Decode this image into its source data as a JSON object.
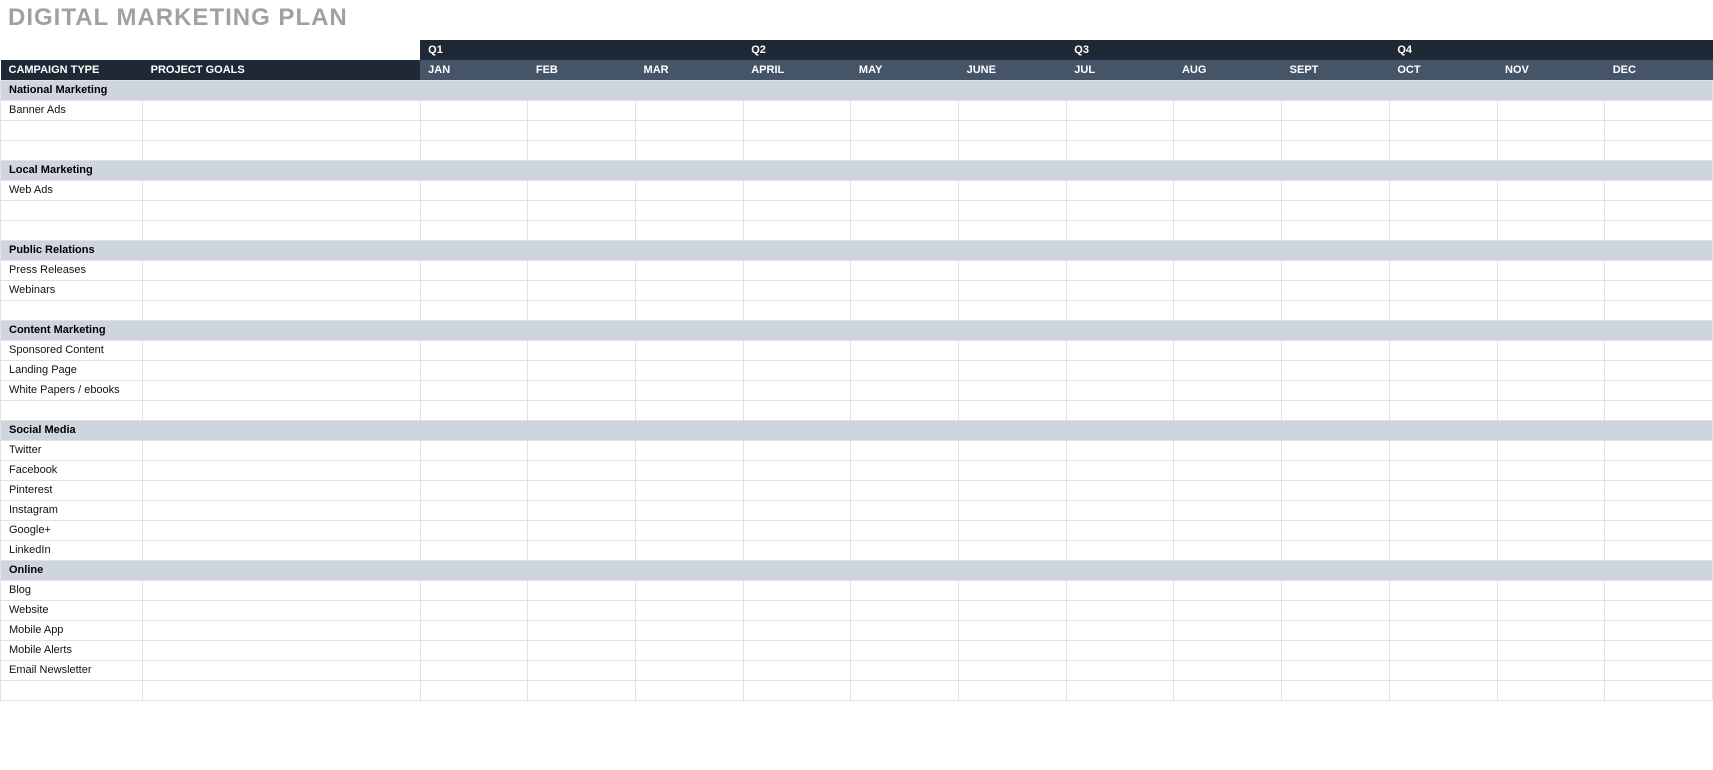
{
  "title": "DIGITAL MARKETING PLAN",
  "header": {
    "campaign_type": "CAMPAIGN TYPE",
    "project_goals": "PROJECT GOALS"
  },
  "quarters": [
    "Q1",
    "Q2",
    "Q3",
    "Q4"
  ],
  "months": [
    "JAN",
    "FEB",
    "MAR",
    "APRIL",
    "MAY",
    "JUNE",
    "JUL",
    "AUG",
    "SEPT",
    "OCT",
    "NOV",
    "DEC"
  ],
  "sections": [
    {
      "name": "National Marketing",
      "rows": [
        "Banner Ads",
        "",
        ""
      ]
    },
    {
      "name": "Local Marketing",
      "rows": [
        "Web Ads",
        "",
        ""
      ]
    },
    {
      "name": "Public Relations",
      "rows": [
        "Press Releases",
        "Webinars",
        ""
      ]
    },
    {
      "name": "Content Marketing",
      "rows": [
        "Sponsored Content",
        "Landing Page",
        "White Papers / ebooks",
        ""
      ]
    },
    {
      "name": "Social Media",
      "rows": [
        "Twitter",
        "Facebook",
        "Pinterest",
        "Instagram",
        "Google+",
        "LinkedIn"
      ]
    },
    {
      "name": "Online",
      "rows": [
        "Blog",
        "Website",
        "Mobile App",
        "Mobile Alerts",
        "Email Newsletter",
        ""
      ]
    }
  ]
}
